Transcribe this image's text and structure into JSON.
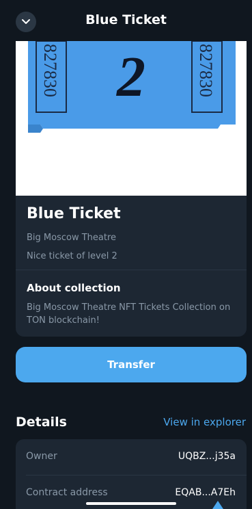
{
  "header": {
    "title": "Blue Ticket",
    "back_icon": "chevron-down-icon"
  },
  "nft": {
    "image": {
      "serial": "827830",
      "number": "2",
      "ticket_color": "#4a9be8"
    },
    "title": "Blue Ticket",
    "collection": "Big Moscow Theatre",
    "description": "Nice ticket of level 2",
    "about_title": "About collection",
    "about_text": "Big Moscow Theatre NFT Tickets Collection on TON blockchain!"
  },
  "actions": {
    "transfer_label": "Transfer"
  },
  "details": {
    "title": "Details",
    "explorer_link": "View in explorer",
    "rows": [
      {
        "label": "Owner",
        "value": "UQBZ...j35a"
      },
      {
        "label": "Contract address",
        "value": "EQAB...A7Eh"
      }
    ]
  },
  "colors": {
    "accent": "#4ca8ee",
    "background": "#10171f",
    "card": "#1d2733"
  }
}
